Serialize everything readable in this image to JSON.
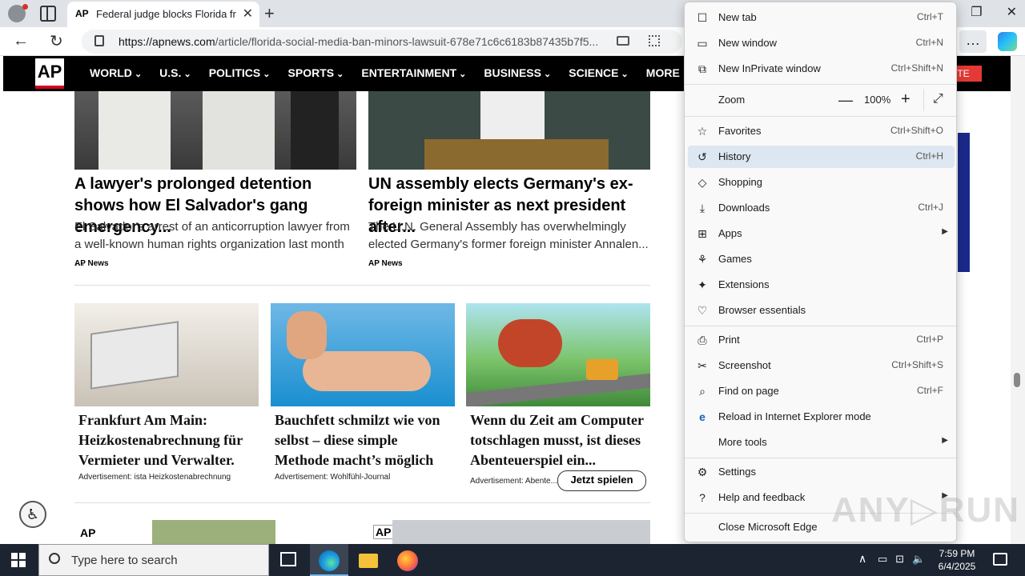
{
  "browser": {
    "tab_title": "Federal judge blocks Florida from",
    "tab_favicon": "AP",
    "url_host": "https://apnews.com",
    "url_path": "/article/florida-social-media-ban-minors-lawsuit-678e71c6c6183b87435b7f5...",
    "more_label": "…"
  },
  "ap_nav": {
    "logo": "AP",
    "items": [
      "WORLD",
      "U.S.",
      "POLITICS",
      "SPORTS",
      "ENTERTAINMENT",
      "BUSINESS",
      "SCIENCE",
      "MORE"
    ],
    "donate": "TE"
  },
  "stories": [
    {
      "title": "A lawyer's prolonged detention shows how El Salvador's gang emergency...",
      "desc": "El Salvador's arrest of an anticorruption lawyer from a well-known human rights organization last month ...",
      "source": "AP News"
    },
    {
      "title": "UN assembly elects Germany's ex-foreign minister as next president after...",
      "desc": "The U.N. General Assembly has overwhelmingly elected Germany's former foreign minister Annalen...",
      "source": "AP News"
    }
  ],
  "ads": [
    {
      "title": "Frankfurt Am Main: Heizkostenabrechnung für Vermieter und Verwalter.",
      "source": "Advertisement:  ista Heizkostenabrechnung"
    },
    {
      "title": "Bauchfett schmilzt wie von selbst – diese simple Methode macht’s möglich",
      "source": "Advertisement:  Wohlfühl-Journal"
    },
    {
      "title": "Wenn du Zeit am Computer totschlagen musst, ist dieses Abenteuerspiel ein...",
      "source": "Advertisement:  Abente...",
      "button": "Jetzt spielen"
    }
  ],
  "ap_thumbs": [
    "AP",
    "AP"
  ],
  "edge_menu": {
    "items": [
      {
        "label": "New tab",
        "shortcut": "Ctrl+T",
        "icon": "new-tab-icon",
        "glyph": "☐"
      },
      {
        "label": "New window",
        "shortcut": "Ctrl+N",
        "icon": "new-window-icon",
        "glyph": "▭"
      },
      {
        "label": "New InPrivate window",
        "shortcut": "Ctrl+Shift+N",
        "icon": "inprivate-icon",
        "glyph": "⧉"
      },
      {
        "label": "Favorites",
        "shortcut": "Ctrl+Shift+O",
        "icon": "favorites-star-icon",
        "glyph": "☆"
      },
      {
        "label": "History",
        "shortcut": "Ctrl+H",
        "icon": "history-icon",
        "glyph": "↺"
      },
      {
        "label": "Shopping",
        "shortcut": "",
        "icon": "shopping-tag-icon",
        "glyph": "◇"
      },
      {
        "label": "Downloads",
        "shortcut": "Ctrl+J",
        "icon": "downloads-icon",
        "glyph": "⤓"
      },
      {
        "label": "Apps",
        "shortcut": "",
        "icon": "apps-icon",
        "glyph": "⊞"
      },
      {
        "label": "Games",
        "shortcut": "",
        "icon": "games-icon",
        "glyph": "⚘"
      },
      {
        "label": "Extensions",
        "shortcut": "",
        "icon": "extensions-puzzle-icon",
        "glyph": "✦"
      },
      {
        "label": "Browser essentials",
        "shortcut": "",
        "icon": "heart-pulse-icon",
        "glyph": "♡"
      },
      {
        "label": "Print",
        "shortcut": "Ctrl+P",
        "icon": "print-icon",
        "glyph": "⎙"
      },
      {
        "label": "Screenshot",
        "shortcut": "Ctrl+Shift+S",
        "icon": "screenshot-icon",
        "glyph": "✂"
      },
      {
        "label": "Find on page",
        "shortcut": "Ctrl+F",
        "icon": "find-icon",
        "glyph": "⌕"
      },
      {
        "label": "Reload in Internet Explorer mode",
        "shortcut": "",
        "icon": "ie-mode-icon",
        "glyph": "e"
      },
      {
        "label": "More tools",
        "shortcut": "",
        "icon": "",
        "glyph": ""
      },
      {
        "label": "Settings",
        "shortcut": "",
        "icon": "settings-gear-icon",
        "glyph": "⚙"
      },
      {
        "label": "Help and feedback",
        "shortcut": "",
        "icon": "help-icon",
        "glyph": "?"
      },
      {
        "label": "Close Microsoft Edge",
        "shortcut": "",
        "icon": "",
        "glyph": ""
      }
    ],
    "zoom_label": "Zoom",
    "zoom_value": "100%",
    "zoom_minus": "—",
    "zoom_plus": "+",
    "zoom_fullscreen": "⤢",
    "submenu_arrow": "▶"
  },
  "watermark": "ANY▷RUN",
  "taskbar": {
    "search_placeholder": "Type here to search",
    "time": "7:59 PM",
    "date": "6/4/2025"
  }
}
